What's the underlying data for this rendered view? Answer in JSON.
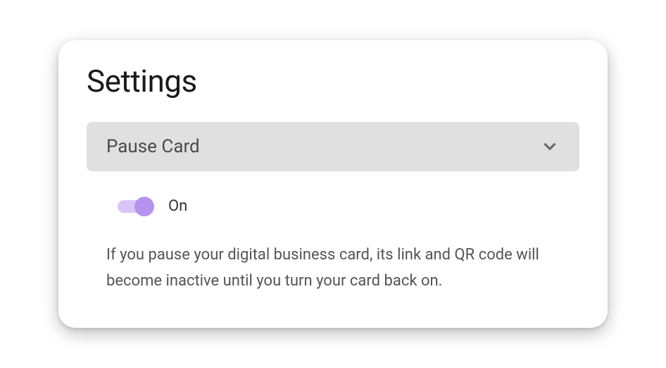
{
  "page": {
    "title": "Settings"
  },
  "accordion": {
    "title": "Pause Card",
    "expanded": true
  },
  "pauseCard": {
    "toggle": {
      "state": "on",
      "label": "On"
    },
    "description": "If you pause your digital business card, its link and QR code will become inactive until you turn your card back on."
  },
  "colors": {
    "toggleTrack": "#d9c6f7",
    "toggleThumb": "#b693f0",
    "accordionBg": "#e0e0e0"
  }
}
